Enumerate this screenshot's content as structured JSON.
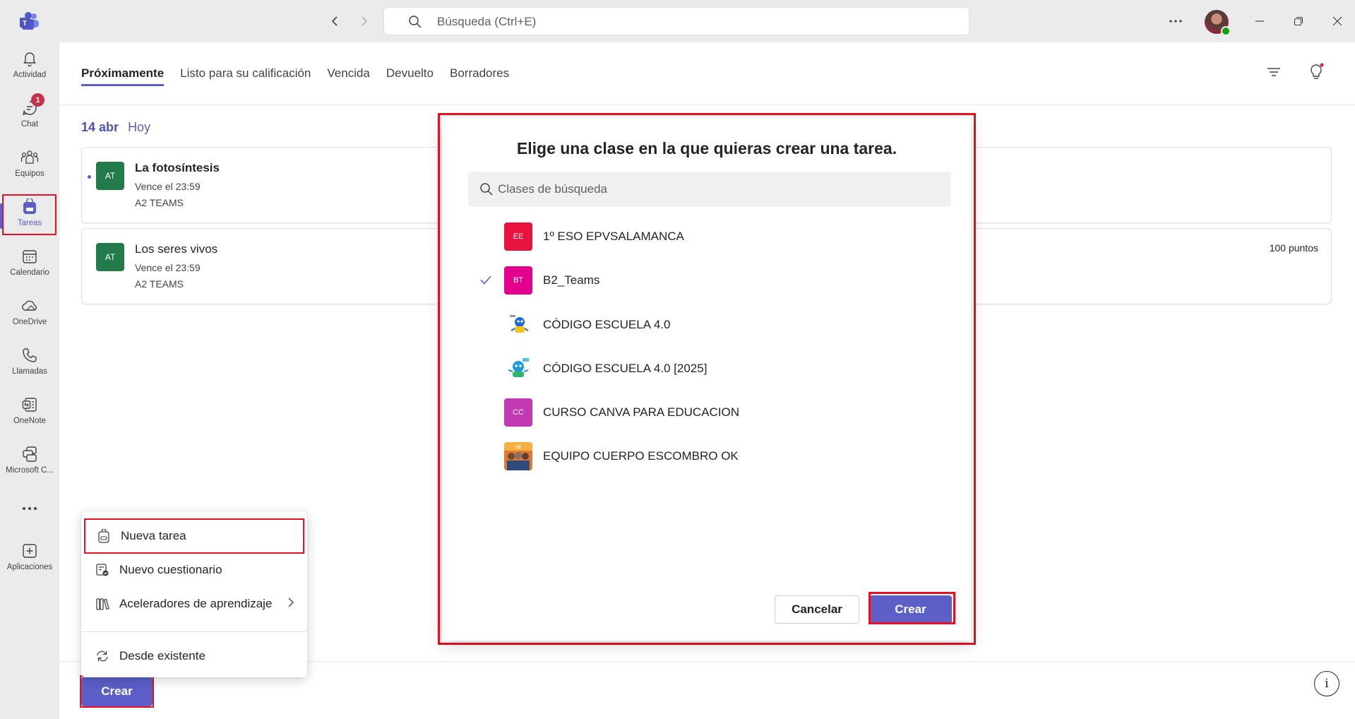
{
  "titlebar": {
    "search_placeholder": "Búsqueda (Ctrl+E)",
    "more_label": "···"
  },
  "rail": {
    "items": [
      {
        "label": "Actividad",
        "icon": "bell-icon"
      },
      {
        "label": "Chat",
        "icon": "chat-icon",
        "badge": "1"
      },
      {
        "label": "Equipos",
        "icon": "teams-icon"
      },
      {
        "label": "Tareas",
        "icon": "backpack-icon",
        "active": true
      },
      {
        "label": "Calendario",
        "icon": "calendar-icon"
      },
      {
        "label": "OneDrive",
        "icon": "cloud-icon"
      },
      {
        "label": "Llamadas",
        "icon": "phone-icon"
      },
      {
        "label": "OneNote",
        "icon": "onenote-icon"
      },
      {
        "label": "Microsoft C...",
        "icon": "copilot-icon"
      },
      {
        "label": "",
        "icon": "more-icon"
      },
      {
        "label": "Aplicaciones",
        "icon": "add-apps-icon"
      }
    ]
  },
  "tabs": [
    "Próximamente",
    "Listo para su calificación",
    "Vencida",
    "Devuelto",
    "Borradores"
  ],
  "date_header": {
    "date": "14 abr",
    "relative": "Hoy"
  },
  "assignments": [
    {
      "avatar": "AT",
      "title": "La fotosíntesis",
      "due": "Vence el 23:59",
      "class": "A2 TEAMS",
      "points": ""
    },
    {
      "avatar": "AT",
      "title": "Los seres vivos",
      "due": "Vence el 23:59",
      "class": "A2 TEAMS",
      "points": "100 puntos"
    }
  ],
  "create_button": "Crear",
  "menu": {
    "items": [
      {
        "label": "Nueva tarea",
        "icon": "backpack-icon"
      },
      {
        "label": "Nuevo cuestionario",
        "icon": "quiz-icon"
      },
      {
        "label": "Aceleradores de aprendizaje",
        "icon": "books-icon",
        "submenu": true
      },
      {
        "label": "Desde existente",
        "icon": "reuse-icon"
      }
    ]
  },
  "dialog": {
    "title": "Elige una clase en la que quieras crear una tarea.",
    "search_placeholder": "Clases de búsqueda",
    "classes": [
      {
        "initials": "EE",
        "name": "1º ESO EPVSALAMANCA",
        "color": "#e8123f",
        "selected": false
      },
      {
        "initials": "BT",
        "name": "B2_Teams",
        "color": "#e3008c",
        "selected": true
      },
      {
        "initials": "",
        "name": "CÓDIGO ESCUELA 4.0",
        "color": "image",
        "selected": false
      },
      {
        "initials": "",
        "name": "CÓDIGO ESCUELA 4.0 [2025]",
        "color": "image",
        "selected": false
      },
      {
        "initials": "CC",
        "name": "CURSO CANVA PARA EDUCACION",
        "color": "#c239b3",
        "selected": false
      },
      {
        "initials": "",
        "name": "EQUIPO CUERPO ESCOMBRO OK",
        "color": "image",
        "selected": false
      }
    ],
    "cancel": "Cancelar",
    "create": "Crear"
  },
  "colors": {
    "accent": "#5b5fc7",
    "highlight": "#e81123",
    "assignment_avatar": "#237b4b"
  }
}
